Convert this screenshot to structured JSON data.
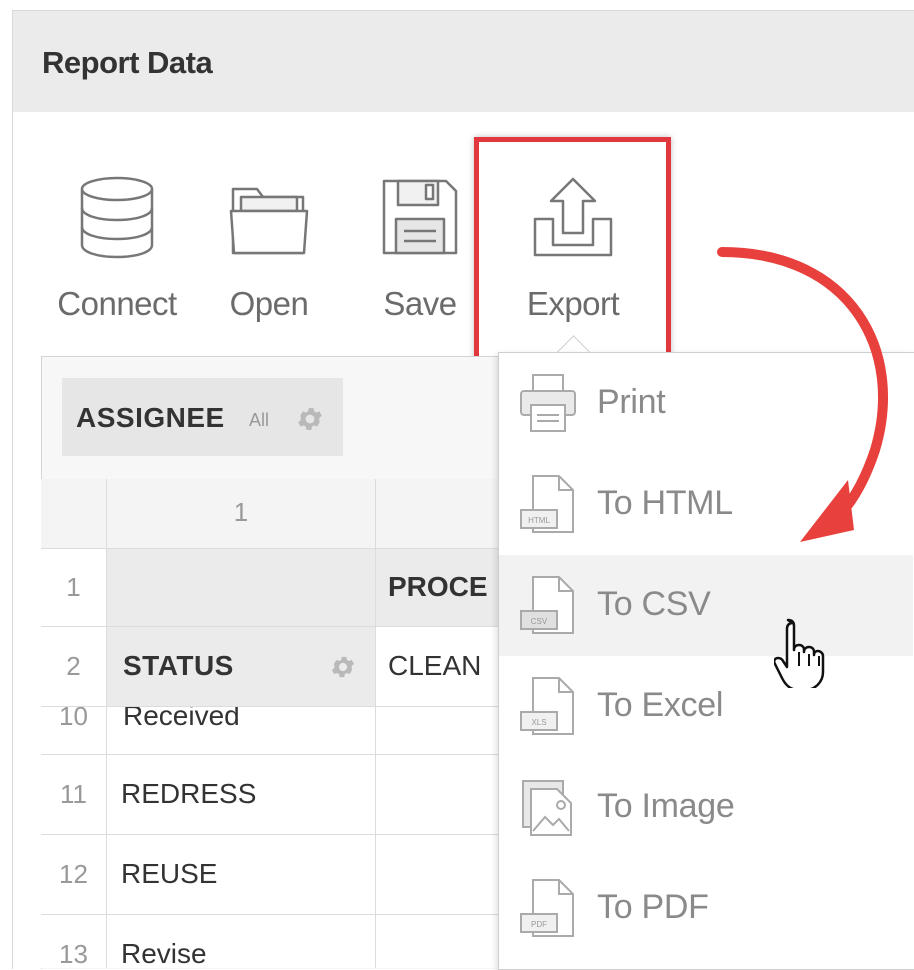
{
  "panel": {
    "title": "Report Data"
  },
  "toolbar": {
    "connect": {
      "label": "Connect",
      "icon": "database-icon"
    },
    "open": {
      "label": "Open",
      "icon": "folder-icon"
    },
    "save": {
      "label": "Save",
      "icon": "floppy-disk-icon"
    },
    "export": {
      "label": "Export",
      "icon": "export-upload-icon"
    }
  },
  "filter": {
    "label": "ASSIGNEE",
    "value": "All",
    "icon": "gear-icon"
  },
  "grid": {
    "col_headers": [
      "1"
    ],
    "rows": [
      {
        "num": "1",
        "cells": [
          "",
          "PROCE"
        ]
      },
      {
        "num": "2",
        "cells": [
          "STATUS",
          "CLEAN"
        ]
      },
      {
        "num": "10",
        "cells": [
          "Received",
          ""
        ]
      },
      {
        "num": "11",
        "cells": [
          "REDRESS",
          ""
        ]
      },
      {
        "num": "12",
        "cells": [
          "REUSE",
          ""
        ]
      },
      {
        "num": "13",
        "cells": [
          "Revise",
          ""
        ]
      }
    ]
  },
  "export_menu": {
    "items": [
      {
        "label": "Print",
        "icon": "printer-icon"
      },
      {
        "label": "To HTML",
        "icon": "html-file-icon",
        "tag": "HTML"
      },
      {
        "label": "To CSV",
        "icon": "csv-file-icon",
        "tag": "CSV"
      },
      {
        "label": "To Excel",
        "icon": "excel-file-icon",
        "tag": "XLS"
      },
      {
        "label": "To Image",
        "icon": "image-file-icon"
      },
      {
        "label": "To PDF",
        "icon": "pdf-file-icon",
        "tag": "PDF"
      }
    ],
    "hovered": "To CSV"
  },
  "colors": {
    "highlight": "#e2373c",
    "header_bg": "#ebebeb",
    "menu_text": "#8a8a8a"
  }
}
